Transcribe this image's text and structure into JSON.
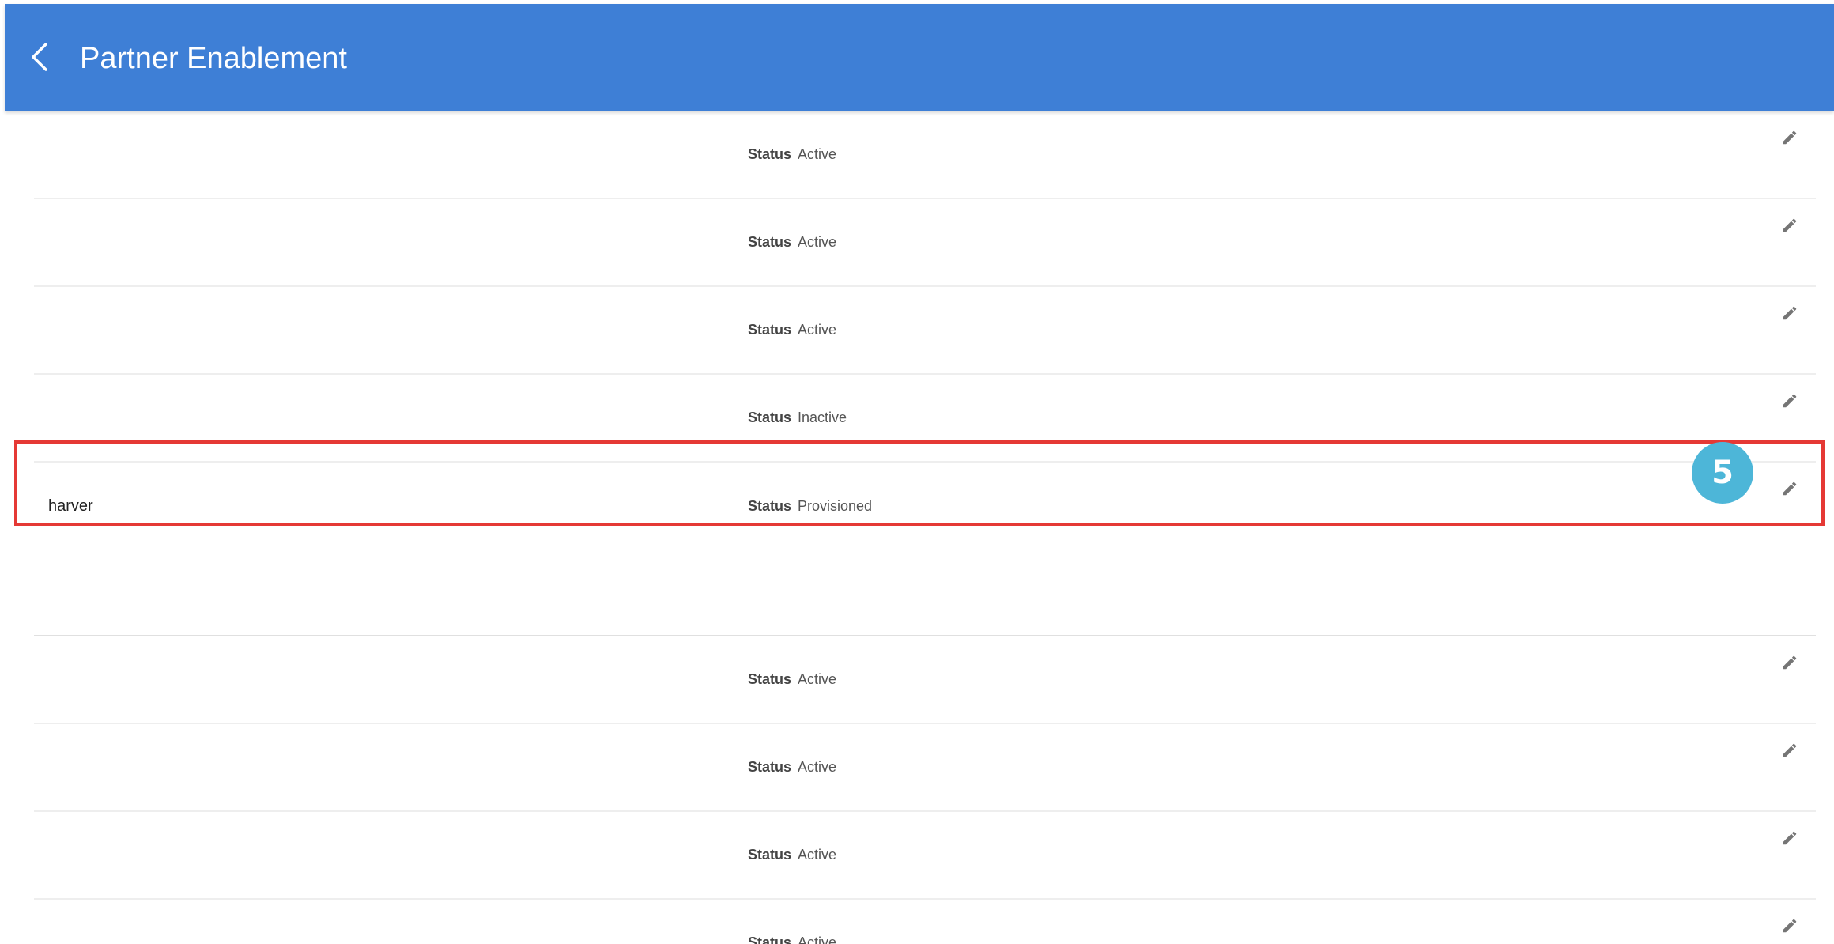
{
  "header": {
    "title": "Partner Enablement",
    "background_color": "#3e7fd6",
    "back_icon": "chevron-left-icon"
  },
  "rows": [
    {
      "name": "",
      "status_label": "Status",
      "status_value": "Active"
    },
    {
      "name": "",
      "status_label": "Status",
      "status_value": "Active"
    },
    {
      "name": "",
      "status_label": "Status",
      "status_value": "Active"
    },
    {
      "name": "",
      "status_label": "Status",
      "status_value": "Inactive"
    },
    {
      "name": "harver",
      "status_label": "Status",
      "status_value": "Provisioned"
    },
    {
      "name": "",
      "status_label": "Status",
      "status_value": "Active"
    },
    {
      "name": "",
      "status_label": "Status",
      "status_value": "Active"
    },
    {
      "name": "",
      "status_label": "Status",
      "status_value": "Active"
    },
    {
      "name": "",
      "status_label": "Status",
      "status_value": "Active"
    }
  ],
  "edit_icon": "pencil-icon",
  "annotation": {
    "step_number": "5",
    "badge_color": "#4db6d8",
    "highlight_color": "#e53935"
  }
}
